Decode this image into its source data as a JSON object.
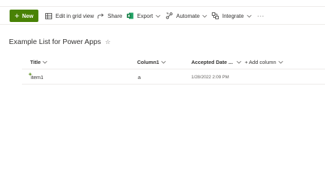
{
  "command_bar": {
    "new_label": "New",
    "edit_grid_label": "Edit in grid view",
    "share_label": "Share",
    "export_label": "Export",
    "automate_label": "Automate",
    "integrate_label": "Integrate",
    "more_label": "···"
  },
  "list": {
    "title": "Example List for Power Apps",
    "favorite_icon": "☆"
  },
  "columns": {
    "title": "Title",
    "column1": "Column1",
    "accepted_date": "Accepted Date ...",
    "add_column": "+ Add column"
  },
  "rows": [
    {
      "title": "item1",
      "column1": "a",
      "accepted_date": "1/28/2022 2:09 PM"
    }
  ],
  "colors": {
    "accent": "#498205",
    "export_icon": "#107c41",
    "text": "#323130",
    "divider": "#edebe9"
  }
}
